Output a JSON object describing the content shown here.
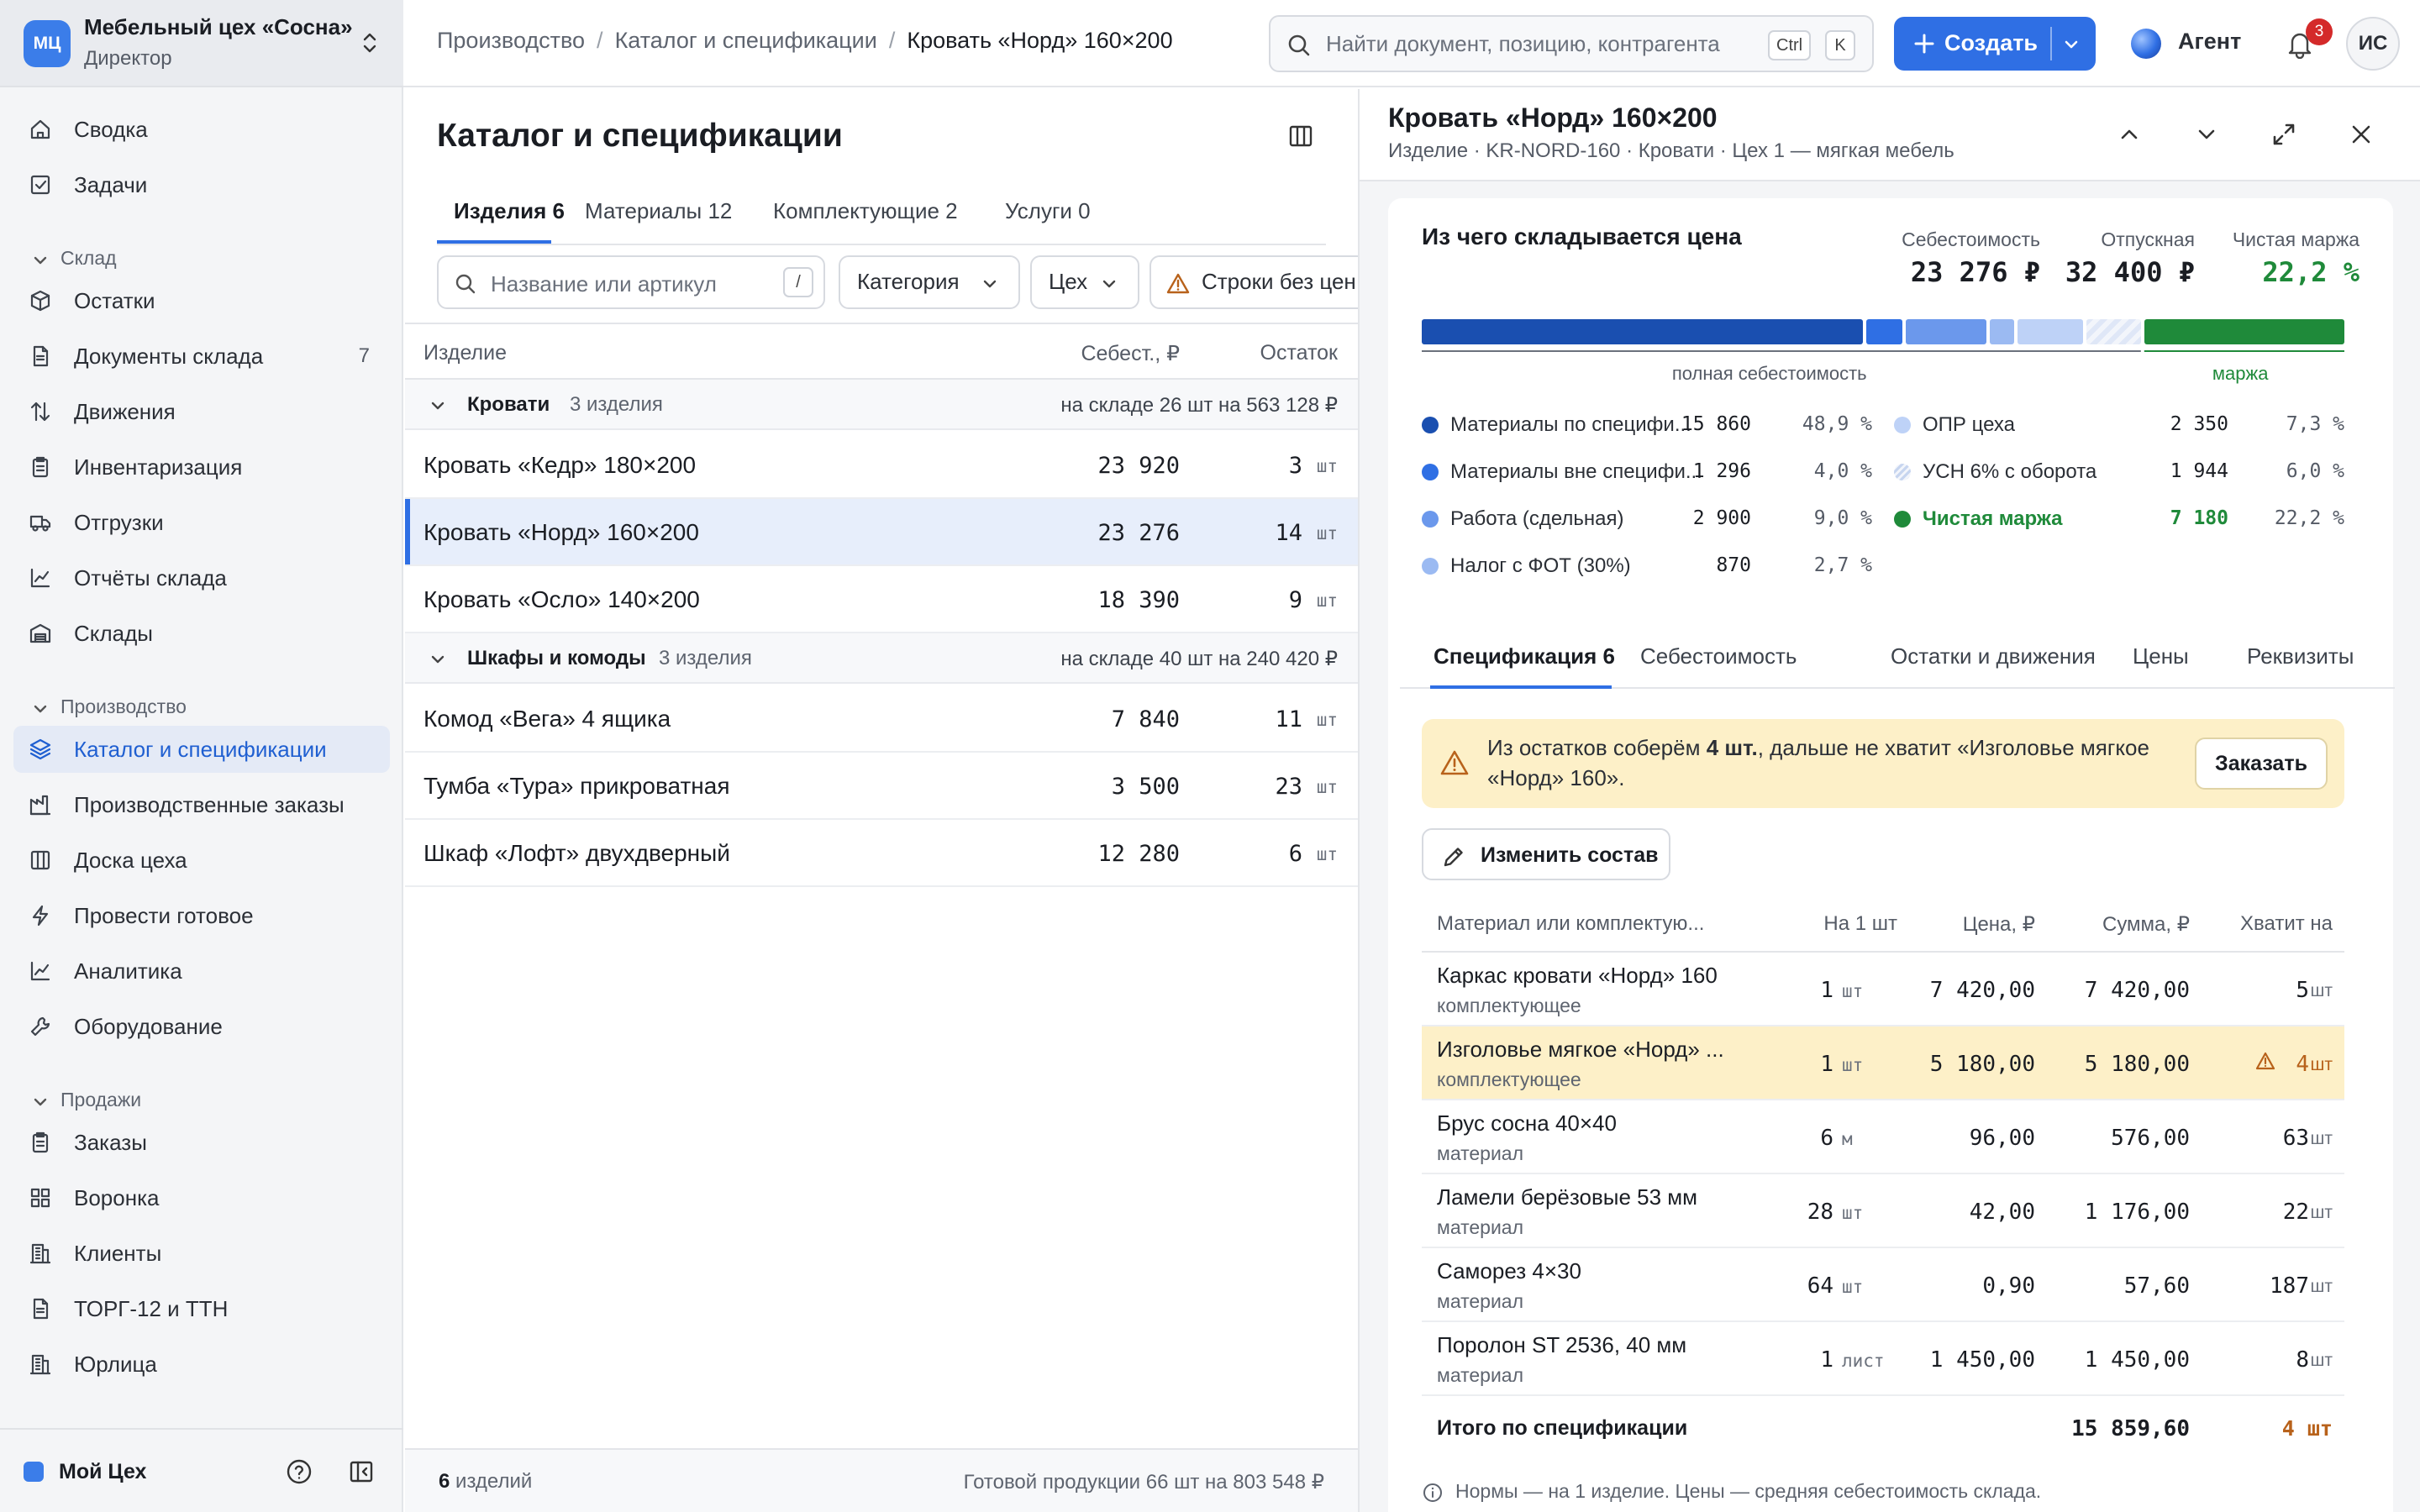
{
  "org": {
    "logo": "МЦ",
    "name": "Мебельный цех «Сосна»",
    "role": "Директор"
  },
  "sidebar": {
    "top": [
      {
        "label": "Сводка",
        "icon": "home-icon"
      },
      {
        "label": "Задачи",
        "icon": "checkbox-icon"
      }
    ],
    "sections": [
      {
        "title": "Склад",
        "items": [
          {
            "label": "Остатки",
            "icon": "box-icon"
          },
          {
            "label": "Документы склада",
            "icon": "document-icon",
            "count": "7"
          },
          {
            "label": "Движения",
            "icon": "arrows-icon"
          },
          {
            "label": "Инвентаризация",
            "icon": "clipboard-icon"
          },
          {
            "label": "Отгрузки",
            "icon": "truck-icon"
          },
          {
            "label": "Отчёты склада",
            "icon": "chart-icon"
          },
          {
            "label": "Склады",
            "icon": "warehouse-icon"
          }
        ]
      },
      {
        "title": "Производство",
        "items": [
          {
            "label": "Каталог и спецификации",
            "icon": "layers-icon",
            "active": true
          },
          {
            "label": "Производственные заказы",
            "icon": "factory-icon"
          },
          {
            "label": "Доска цеха",
            "icon": "board-icon"
          },
          {
            "label": "Провести готовое",
            "icon": "bolt-icon"
          },
          {
            "label": "Аналитика",
            "icon": "chart-icon"
          },
          {
            "label": "Оборудование",
            "icon": "wrench-icon"
          }
        ]
      },
      {
        "title": "Продажи",
        "items": [
          {
            "label": "Заказы",
            "icon": "clipboard-icon"
          },
          {
            "label": "Воронка",
            "icon": "grid-icon"
          },
          {
            "label": "Клиенты",
            "icon": "building-icon"
          },
          {
            "label": "ТОРГ-12 и ТТН",
            "icon": "document-icon"
          },
          {
            "label": "Юрлица",
            "icon": "building-icon"
          }
        ]
      }
    ],
    "workspace": "Мой Цех"
  },
  "topbar": {
    "breadcrumbs": [
      "Производство",
      "Каталог и спецификации",
      "Кровать «Норд» 160×200"
    ],
    "search_placeholder": "Найти документ, позицию, контрагента",
    "kbd_ctrl": "Ctrl",
    "kbd_k": "K",
    "create_label": "Создать",
    "agent_label": "Агент",
    "notifications": "3",
    "avatar": "ИС"
  },
  "catalog": {
    "title": "Каталог и спецификации",
    "tabs": [
      {
        "label": "Изделия 6",
        "active": true
      },
      {
        "label": "Материалы 12"
      },
      {
        "label": "Комплектующие 2"
      },
      {
        "label": "Услуги 0"
      }
    ],
    "filter_placeholder": "Название или артикул",
    "filter_kbd": "/",
    "chips": [
      "Категория",
      "Цех",
      "Строки без цен"
    ],
    "columns": {
      "name": "Изделие",
      "cost": "Себест., ₽",
      "stock": "Остаток"
    },
    "groups": [
      {
        "name": "Кровати",
        "count": "3 изделия",
        "summary": "на складе 26 шт на 563 128 ₽",
        "rows": [
          {
            "name": "Кровать «Кедр» 180×200",
            "cost": "23 920",
            "stock": "3",
            "unit": "шт"
          },
          {
            "name": "Кровать «Норд» 160×200",
            "cost": "23 276",
            "stock": "14",
            "unit": "шт",
            "selected": true
          },
          {
            "name": "Кровать «Осло» 140×200",
            "cost": "18 390",
            "stock": "9",
            "unit": "шт"
          }
        ]
      },
      {
        "name": "Шкафы и комоды",
        "count": "3 изделия",
        "summary": "на складе 40 шт на 240 420 ₽",
        "rows": [
          {
            "name": "Комод «Вега» 4 ящика",
            "cost": "7 840",
            "stock": "11",
            "unit": "шт"
          },
          {
            "name": "Тумба «Тура» прикроватная",
            "cost": "3 500",
            "stock": "23",
            "unit": "шт"
          },
          {
            "name": "Шкаф «Лофт» двухдверный",
            "cost": "12 280",
            "stock": "6",
            "unit": "шт"
          }
        ]
      }
    ],
    "footer_count": "6",
    "footer_count_label": "изделий",
    "footer_summary": "Готовой продукции 66 шт на 803 548 ₽"
  },
  "detail": {
    "title": "Кровать «Норд» 160×200",
    "subtitle": "Изделие · KR-NORD-160 · Кровати · Цех 1 — мягкая мебель",
    "price": {
      "title": "Из чего складывается цена",
      "kpis": [
        {
          "label": "Себестоимость",
          "value": "23 276 ₽"
        },
        {
          "label": "Отпускная",
          "value": "32 400 ₽"
        },
        {
          "label": "Чистая маржа",
          "value": "22,2 %",
          "positive": true
        }
      ],
      "cost_label": "полная себестоимость",
      "margin_label": "маржа",
      "components": [
        {
          "name": "Материалы по специфи...",
          "value": "15 860",
          "pct": "48,9 %",
          "share": 48.9,
          "color": "#1a4fb0"
        },
        {
          "name": "Материалы вне специфи...",
          "value": "1 296",
          "pct": "4,0 %",
          "share": 4.0,
          "color": "#2f6fe4"
        },
        {
          "name": "Работа (сдельная)",
          "value": "2 900",
          "pct": "9,0 %",
          "share": 9.0,
          "color": "#6b98ec"
        },
        {
          "name": "Налог с ФОТ (30%)",
          "value": "870",
          "pct": "2,7 %",
          "share": 2.7,
          "color": "#9bbaf2"
        },
        {
          "name": "ОПР цеха",
          "value": "2 350",
          "pct": "7,3 %",
          "share": 7.3,
          "color": "#bed2f7"
        },
        {
          "name": "УСН 6% с оборота",
          "value": "1 944",
          "pct": "6,0 %",
          "share": 6.0,
          "color": "hatch"
        },
        {
          "name": "Чистая маржа",
          "value": "7 180",
          "pct": "22,2 %",
          "share": 22.2,
          "color": "#1f8a3a",
          "margin": true
        }
      ]
    },
    "tabs": [
      {
        "label": "Спецификация 6",
        "active": true
      },
      {
        "label": "Себестоимость"
      },
      {
        "label": "Остатки и движения"
      },
      {
        "label": "Цены"
      },
      {
        "label": "Реквизиты"
      }
    ],
    "warning": {
      "pre": "Из остатков соберём ",
      "bold": "4 шт.",
      "post": ", дальше не хватит «Изголовье мягкое «Норд» 160».",
      "button": "Заказать"
    },
    "edit_button": "Изменить состав",
    "spec": {
      "columns": {
        "name": "Материал или комплектую...",
        "qty": "На 1 шт",
        "price": "Цена, ₽",
        "sum": "Сумма, ₽",
        "enough": "Хватит на"
      },
      "rows": [
        {
          "name": "Каркас кровати «Норд» 160",
          "kind": "комплектующее",
          "qty": "1",
          "qty_unit": "шт",
          "price": "7 420,00",
          "sum": "7 420,00",
          "enough": "5",
          "enough_unit": "шт"
        },
        {
          "name": "Изголовье мягкое «Норд» ...",
          "kind": "комплектующее",
          "qty": "1",
          "qty_unit": "шт",
          "price": "5 180,00",
          "sum": "5 180,00",
          "enough": "4",
          "enough_unit": "шт",
          "warn": true
        },
        {
          "name": "Брус сосна 40×40",
          "kind": "материал",
          "qty": "6",
          "qty_unit": "м",
          "price": "96,00",
          "sum": "576,00",
          "enough": "63",
          "enough_unit": "шт"
        },
        {
          "name": "Ламели берёзовые 53 мм",
          "kind": "материал",
          "qty": "28",
          "qty_unit": "шт",
          "price": "42,00",
          "sum": "1 176,00",
          "enough": "22",
          "enough_unit": "шт"
        },
        {
          "name": "Саморез 4×30",
          "kind": "материал",
          "qty": "64",
          "qty_unit": "шт",
          "price": "0,90",
          "sum": "57,60",
          "enough": "187",
          "enough_unit": "шт"
        },
        {
          "name": "Поролон ST 2536, 40 мм",
          "kind": "материал",
          "qty": "1",
          "qty_unit": "лист",
          "price": "1 450,00",
          "sum": "1 450,00",
          "enough": "8",
          "enough_unit": "шт"
        }
      ],
      "total_label": "Итого по спецификации",
      "total_sum": "15 859,60",
      "total_enough": "4 шт"
    },
    "note": "Нормы — на 1 изделие. Цены — средняя себестоимость склада."
  },
  "colors": {
    "accent": "#2f6fe4",
    "positive": "#1f8a3a",
    "warning_bg": "#fdf0c8",
    "warning_text": "#b8621b",
    "badge": "#d42a2a"
  }
}
